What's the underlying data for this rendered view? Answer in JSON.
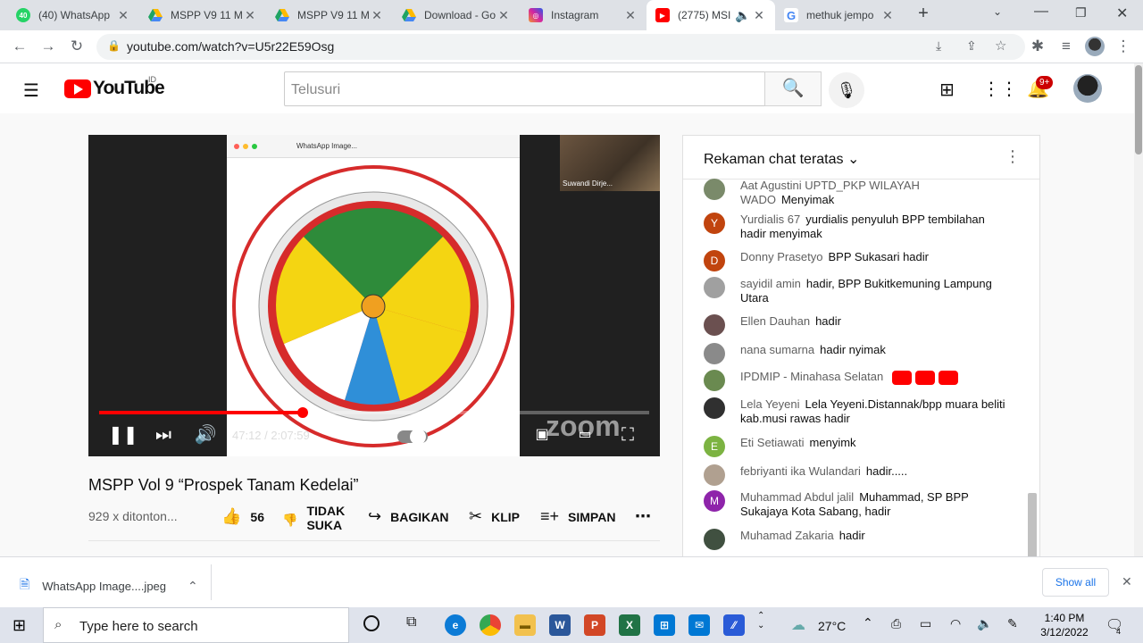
{
  "browser": {
    "tabs": [
      {
        "title": "(40) WhatsApp",
        "icon": "whatsapp-icon",
        "color": "#25d366",
        "badge": "40"
      },
      {
        "title": "MSPP V9 11 M",
        "icon": "drive-icon",
        "color": "#1fa463"
      },
      {
        "title": "MSPP V9 11 M",
        "icon": "drive-icon",
        "color": "#1fa463"
      },
      {
        "title": "Download - Go",
        "icon": "drive-icon",
        "color": "#1fa463"
      },
      {
        "title": "Instagram",
        "icon": "instagram-icon",
        "color": "#d6249f"
      },
      {
        "title": "(2775) MSI",
        "icon": "youtube-icon",
        "color": "#ff0000"
      },
      {
        "title": "methuk jempo",
        "icon": "google-icon",
        "color": "#4285f4"
      }
    ],
    "url": "youtube.com/watch?v=U5r22E59Osg"
  },
  "youtube": {
    "logo_text": "YouTube",
    "region": "ID",
    "search_placeholder": "Telusuri",
    "notif_badge": "9+"
  },
  "player": {
    "time": "47:12 / 2:07:59",
    "progress": 0.37,
    "cam_name": "Suwandi Dirje...",
    "slide_title": "WhatsApp Image...",
    "zoom_watermark": "zoom"
  },
  "video": {
    "title": "MSPP Vol 9 “Prospek Tanam Kedelai”",
    "views": "929 x ditonton...",
    "likes": "56",
    "dislike_label_1": "TIDAK",
    "dislike_label_2": "SUKA",
    "share": "BAGIKAN",
    "clip": "KLIP",
    "save": "SIMPAN"
  },
  "chat": {
    "header": "Rekaman chat teratas",
    "messages": [
      {
        "name": "Aat Agustini UPTD_PKP WILAYAH WADO",
        "text": "Menyimak",
        "initial": "",
        "color": "#7a8a6a"
      },
      {
        "name": "Yurdialis 67",
        "text": "yurdialis penyuluh BPP tembilahan hadir menyimak",
        "initial": "Y",
        "color": "#c1440e"
      },
      {
        "name": "Donny Prasetyo",
        "text": "BPP Sukasari hadir",
        "initial": "D",
        "color": "#c1440e"
      },
      {
        "name": "sayidil amin",
        "text": "hadir, BPP Bukitkemuning Lampung Utara",
        "initial": "",
        "color": "#a0a0a0"
      },
      {
        "name": "Ellen Dauhan",
        "text": "hadir",
        "initial": "",
        "color": "#6b5050"
      },
      {
        "name": "nana sumarna",
        "text": "hadir nyimak",
        "initial": "",
        "color": "#8a8a8a"
      },
      {
        "name": "IPDMIP - Minahasa Selatan",
        "text": "",
        "initial": "",
        "color": "#6a8a50"
      },
      {
        "name": "Lela Yeyeni",
        "text": "Lela Yeyeni.Distannak/bpp muara beliti kab.musi rawas hadir",
        "initial": "",
        "color": "#303030"
      },
      {
        "name": "Eti Setiawati",
        "text": "menyimk",
        "initial": "E",
        "color": "#7cb342"
      },
      {
        "name": "febriyanti ika Wulandari",
        "text": "hadir.....",
        "initial": "",
        "color": "#b0a090"
      },
      {
        "name": "Muhammad Abdul jalil",
        "text": "Muhammad, SP BPP Sukajaya Kota Sabang, hadir",
        "initial": "M",
        "color": "#8e24aa"
      },
      {
        "name": "Muhamad Zakaria",
        "text": "hadir",
        "initial": "",
        "color": "#405040"
      }
    ]
  },
  "download": {
    "file": "WhatsApp Image....jpeg",
    "show_all": "Show all"
  },
  "taskbar": {
    "search": "Type here to search",
    "temp": "27°C",
    "time": "1:40 PM",
    "date": "3/12/2022",
    "notif": "4"
  }
}
